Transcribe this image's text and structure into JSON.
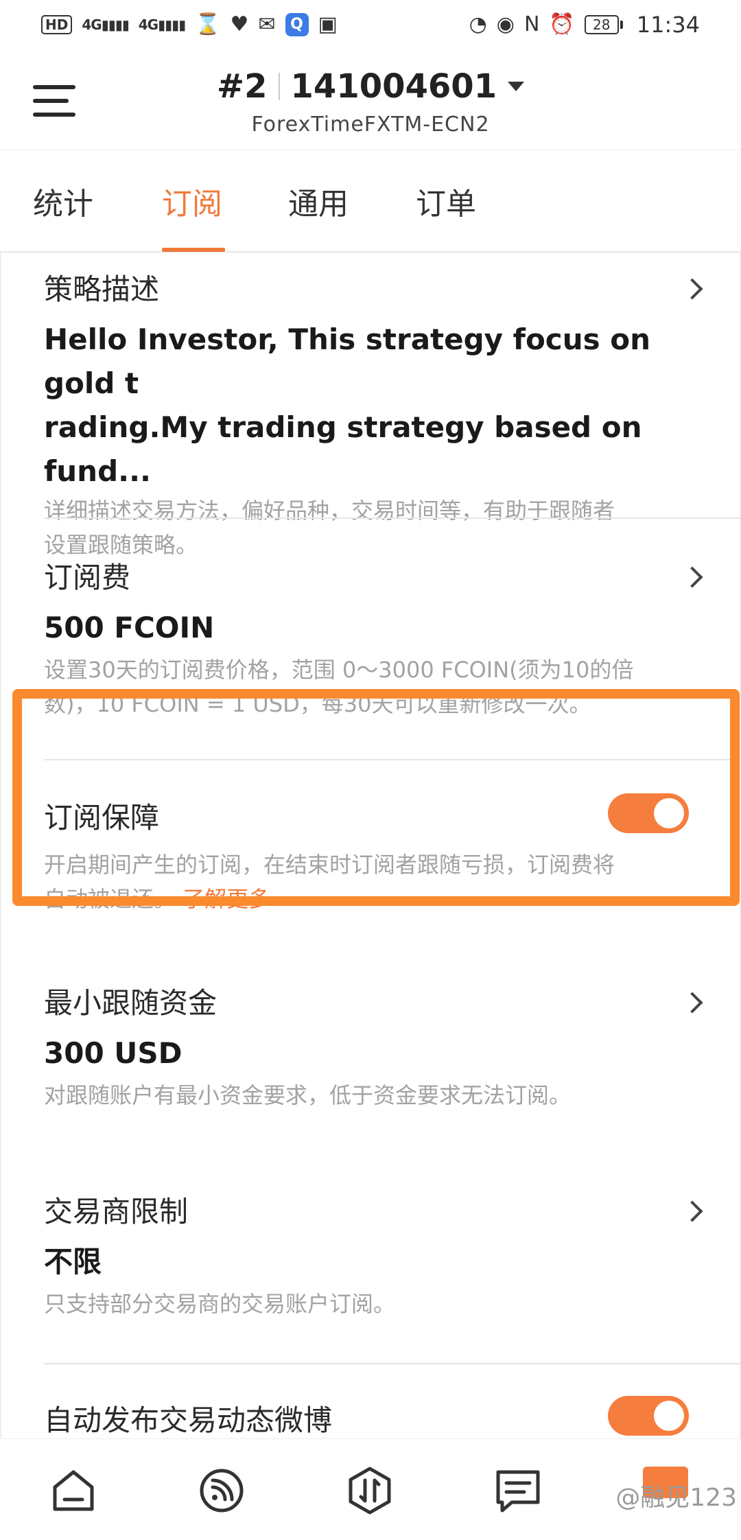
{
  "status_bar": {
    "hd_label": "HD",
    "signal1": "4G",
    "signal2": "4G",
    "battery": "28",
    "time": "11:34"
  },
  "header": {
    "account_index": "#2",
    "account_number": "141004601",
    "broker": "ForexTimeFXTM-ECN2"
  },
  "tabs": [
    {
      "label": "统计"
    },
    {
      "label": "订阅"
    },
    {
      "label": "通用"
    },
    {
      "label": "订单"
    }
  ],
  "active_tab": "订阅",
  "sections": {
    "strategy": {
      "title": "策略描述",
      "value_line1": "Hello Investor, This strategy focus on gold t",
      "value_line2": "rading.My trading strategy based on fund...",
      "desc_line1": "详细描述交易方法，偏好品种，交易时间等，有助于跟随者",
      "desc_line2": "设置跟随策略。"
    },
    "fee": {
      "title": "订阅费",
      "value": "500 FCOIN",
      "desc_line1": "设置30天的订阅费价格，范围 0～3000 FCOIN(须为10的倍",
      "desc_line2": "数)，10 FCOIN = 1 USD，每30天可以重新修改一次。"
    },
    "protection": {
      "title": "订阅保障",
      "toggle_on": true,
      "desc_line1": "开启期间产生的订阅，在结束时订阅者跟随亏损，订阅费将",
      "desc_line2": "自动被退还。",
      "link": "了解更多"
    },
    "min_funds": {
      "title": "最小跟随资金",
      "value": "300 USD",
      "desc": "对跟随账户有最小资金要求，低于资金要求无法订阅。"
    },
    "broker_limit": {
      "title": "交易商限制",
      "value": "不限",
      "desc": "只支持部分交易商的交易账户订阅。"
    },
    "auto_post": {
      "title": "自动发布交易动态微博",
      "toggle_on": true
    }
  },
  "bottom_nav": {
    "items": [
      "home-icon",
      "feed-icon",
      "trade-icon",
      "messages-icon",
      "me-icon"
    ],
    "watermark": "@融见123"
  },
  "colors": {
    "accent": "#f07a3b",
    "toggle": "#f57d3d",
    "highlight": "#fb8a2e",
    "desc_text": "#a2a2a2"
  }
}
